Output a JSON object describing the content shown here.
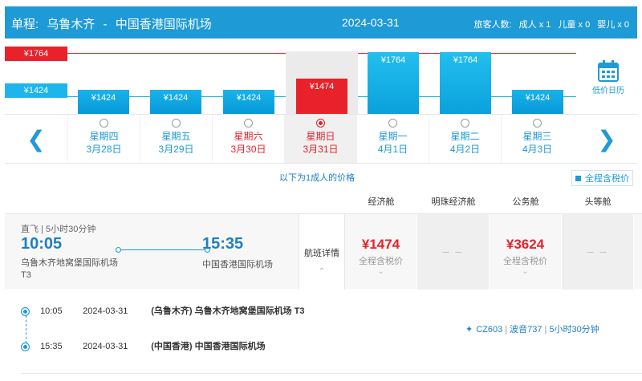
{
  "header": {
    "trip_type": "单程:",
    "origin": "乌鲁木齐",
    "separator": "-",
    "destination": "中国香港国际机场",
    "date": "2024-03-31",
    "pax_label": "旅客人数:",
    "adult": "成人 x 1",
    "child": "儿童 x 0",
    "infant": "婴儿 x 0"
  },
  "price_chart": {
    "high_label": "¥1764",
    "low_label": "¥1424",
    "high_color": "#e8212b",
    "low_color": "#1eb5ec"
  },
  "calendar_button": {
    "label": "低价日历",
    "icon": "calendar-icon"
  },
  "days": [
    {
      "weekday": "星期四",
      "date": "3月28日",
      "price": "¥1424",
      "price_value": 1424,
      "weekend": false,
      "selected": false
    },
    {
      "weekday": "星期五",
      "date": "3月29日",
      "price": "¥1424",
      "price_value": 1424,
      "weekend": false,
      "selected": false
    },
    {
      "weekday": "星期六",
      "date": "3月30日",
      "price": "¥1424",
      "price_value": 1424,
      "weekend": true,
      "selected": false
    },
    {
      "weekday": "星期日",
      "date": "3月31日",
      "price": "¥1474",
      "price_value": 1474,
      "weekend": true,
      "selected": true
    },
    {
      "weekday": "星期一",
      "date": "4月1日",
      "price": "¥1764",
      "price_value": 1764,
      "weekend": false,
      "selected": false
    },
    {
      "weekday": "星期二",
      "date": "4月2日",
      "price": "¥1764",
      "price_value": 1764,
      "weekend": false,
      "selected": false
    },
    {
      "weekday": "星期三",
      "date": "4月3日",
      "price": "¥1424",
      "price_value": 1424,
      "weekend": false,
      "selected": false
    }
  ],
  "note": "以下为1成人的价格",
  "tax_toggle": "全程含税价",
  "cabins": [
    "经济舱",
    "明珠经济舱",
    "公务舱",
    "头等舱"
  ],
  "flight": {
    "type_duration": "直飞 | 5小时30分钟",
    "dep_time": "10:05",
    "arr_time": "15:35",
    "dep_airport": "乌鲁木齐地窝堡国际机场 T3",
    "arr_airport": "中国香港国际机场",
    "details_label": "航班详情",
    "fares": [
      {
        "price": "¥1474",
        "tax": "全程含税价"
      },
      {
        "na": "– –"
      },
      {
        "price": "¥3624",
        "tax": "全程含税价"
      },
      {
        "na": "– –"
      }
    ]
  },
  "legs": [
    {
      "time": "10:05",
      "date": "2024-03-31",
      "airport": "(乌鲁木齐) 乌鲁木齐地窝堡国际机场 T3"
    },
    {
      "time": "15:35",
      "date": "2024-03-31",
      "airport": "(中国香港) 中国香港国际机场"
    }
  ],
  "flight_info": {
    "number": "CZ603",
    "aircraft": "波音737",
    "duration": "5小时30分钟"
  }
}
